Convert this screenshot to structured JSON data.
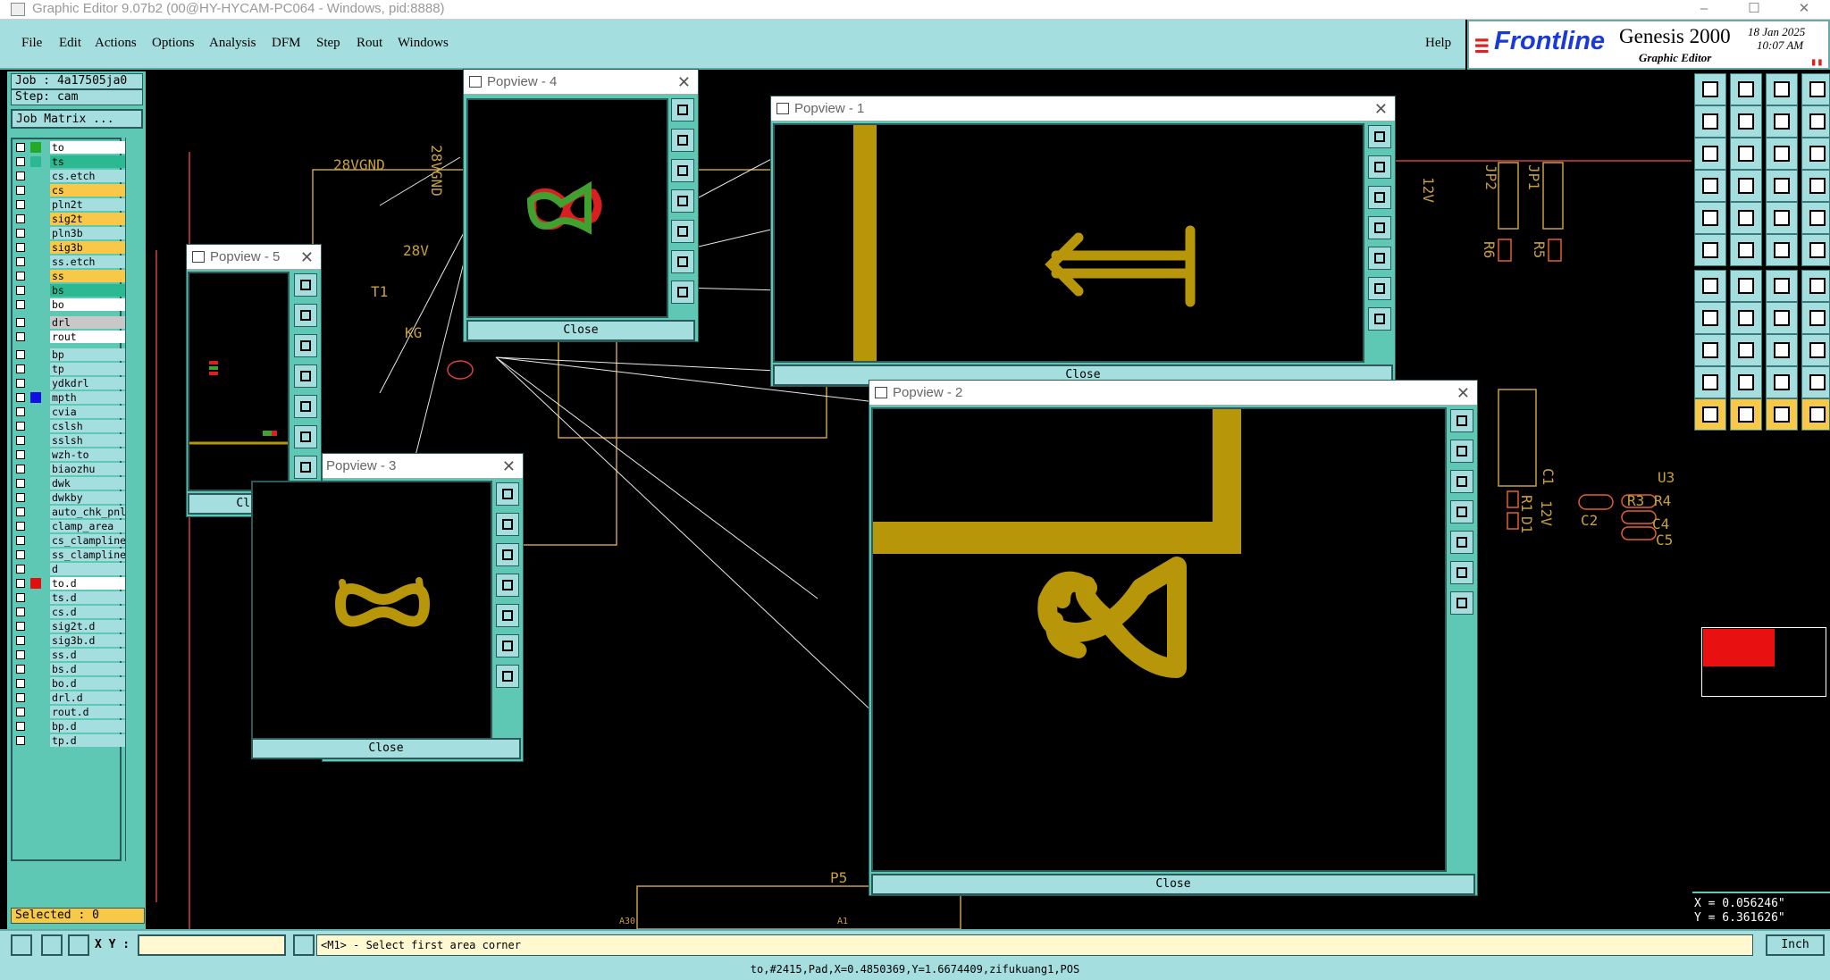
{
  "window": {
    "title": "Graphic Editor 9.07b2 (00@HY-HYCAM-PC064 - Windows, pid:8888)",
    "min": "–",
    "max": "☐",
    "close": "✕"
  },
  "menu": {
    "items": [
      "File",
      "Edit",
      "Actions",
      "Options",
      "Analysis",
      "DFM",
      "Step",
      "Rout",
      "Windows"
    ],
    "help": "Help"
  },
  "logo": {
    "brand": "Frontline",
    "product": "Genesis 2000",
    "subtitle": "Graphic Editor",
    "date": "18 Jan 2025",
    "time": "10:07 AM"
  },
  "job": {
    "job": "Job : 4a17505ja0",
    "step": "Step: cam",
    "matrix": "Job Matrix ..."
  },
  "layers": [
    {
      "name": "to",
      "color": "#ffffff",
      "mark": "#28a828"
    },
    {
      "name": "ts",
      "color": "#2cb890",
      "mark": "#2cb890"
    },
    {
      "name": "cs.etch",
      "color": "#a4dede",
      "mark": ""
    },
    {
      "name": "cs",
      "color": "#f8c848",
      "mark": ""
    },
    {
      "name": "pln2t",
      "color": "#a4dede",
      "mark": ""
    },
    {
      "name": "sig2t",
      "color": "#f8c848",
      "mark": ""
    },
    {
      "name": "pln3b",
      "color": "#a4dede",
      "mark": ""
    },
    {
      "name": "sig3b",
      "color": "#f8c848",
      "mark": ""
    },
    {
      "name": "ss.etch",
      "color": "#a4dede",
      "mark": ""
    },
    {
      "name": "ss",
      "color": "#f8c848",
      "mark": ""
    },
    {
      "name": "bs",
      "color": "#2cb890",
      "mark": ""
    },
    {
      "name": "bo",
      "color": "#ffffff",
      "mark": ""
    },
    {
      "name": "drl",
      "color": "#c8c8c8",
      "mark": ""
    },
    {
      "name": "rout",
      "color": "#ffffff",
      "mark": ""
    },
    {
      "name": "bp",
      "color": "#a4dede",
      "mark": ""
    },
    {
      "name": "tp",
      "color": "#a4dede",
      "mark": ""
    },
    {
      "name": "ydkdrl",
      "color": "#a4dede",
      "mark": ""
    },
    {
      "name": "mpth",
      "color": "#a4dede",
      "mark": "#1010e0"
    },
    {
      "name": "cvia",
      "color": "#a4dede",
      "mark": ""
    },
    {
      "name": "cslsh",
      "color": "#a4dede",
      "mark": ""
    },
    {
      "name": "sslsh",
      "color": "#a4dede",
      "mark": ""
    },
    {
      "name": "wzh-to",
      "color": "#a4dede",
      "mark": ""
    },
    {
      "name": "biaozhu",
      "color": "#a4dede",
      "mark": ""
    },
    {
      "name": "dwk",
      "color": "#a4dede",
      "mark": ""
    },
    {
      "name": "dwkby",
      "color": "#a4dede",
      "mark": ""
    },
    {
      "name": "auto_chk_pnl",
      "color": "#a4dede",
      "mark": ""
    },
    {
      "name": "clamp_area",
      "color": "#a4dede",
      "mark": ""
    },
    {
      "name": "cs_clampline",
      "color": "#a4dede",
      "mark": ""
    },
    {
      "name": "ss_clampline",
      "color": "#a4dede",
      "mark": ""
    },
    {
      "name": "d",
      "color": "#a4dede",
      "mark": ""
    },
    {
      "name": "to.d",
      "color": "#ffffff",
      "mark": "#e01010"
    },
    {
      "name": "ts.d",
      "color": "#a4dede",
      "mark": ""
    },
    {
      "name": "cs.d",
      "color": "#a4dede",
      "mark": ""
    },
    {
      "name": "sig2t.d",
      "color": "#a4dede",
      "mark": ""
    },
    {
      "name": "sig3b.d",
      "color": "#a4dede",
      "mark": ""
    },
    {
      "name": "ss.d",
      "color": "#a4dede",
      "mark": ""
    },
    {
      "name": "bs.d",
      "color": "#a4dede",
      "mark": ""
    },
    {
      "name": "bo.d",
      "color": "#a4dede",
      "mark": ""
    },
    {
      "name": "drl.d",
      "color": "#a4dede",
      "mark": ""
    },
    {
      "name": "rout.d",
      "color": "#a4dede",
      "mark": ""
    },
    {
      "name": "bp.d",
      "color": "#a4dede",
      "mark": ""
    },
    {
      "name": "tp.d",
      "color": "#a4dede",
      "mark": ""
    }
  ],
  "selected": "Selected : 0",
  "board_labels": {
    "net1": "28VGND",
    "net2": "28VGND",
    "net3": "28V",
    "t1": "T1",
    "kg": "KG",
    "v12a": "12V",
    "v12b": "12V",
    "jp2": "JP2",
    "jp1": "JP1",
    "r6": "R6",
    "r5": "R5",
    "c1": "C1",
    "r1": "R1",
    "d1": "D1",
    "c2": "C2",
    "r3": "R3",
    "r4": "R4",
    "c4": "C4",
    "c5": "C5",
    "u3": "U3",
    "p5": "P5",
    "a1": "A1",
    "a30": "A30"
  },
  "popviews": [
    {
      "title": "Popview - 4",
      "close": "Close"
    },
    {
      "title": "Popview - 1",
      "close": "Close"
    },
    {
      "title": "Popview - 5",
      "close": "Close"
    },
    {
      "title": "Popview - 3",
      "close": "Close"
    },
    {
      "title": "Popview - 2",
      "close": "Close"
    }
  ],
  "coords": {
    "x": "X = 0.056246\"",
    "y": "Y = 6.361626\""
  },
  "status": {
    "xy_label": "X Y :",
    "xy_value": "",
    "prompt": "<M1> - Select first area corner",
    "units": "Inch"
  },
  "bottom_info": "to,#2415,Pad,X=0.4850369,Y=1.6674409,zifukuang1,POS",
  "colors": {
    "panel": "#a4dede",
    "dark_panel": "#5ec8b4",
    "copper": "#b8960a",
    "outline": "#c8a040",
    "trace": "#d04040"
  }
}
